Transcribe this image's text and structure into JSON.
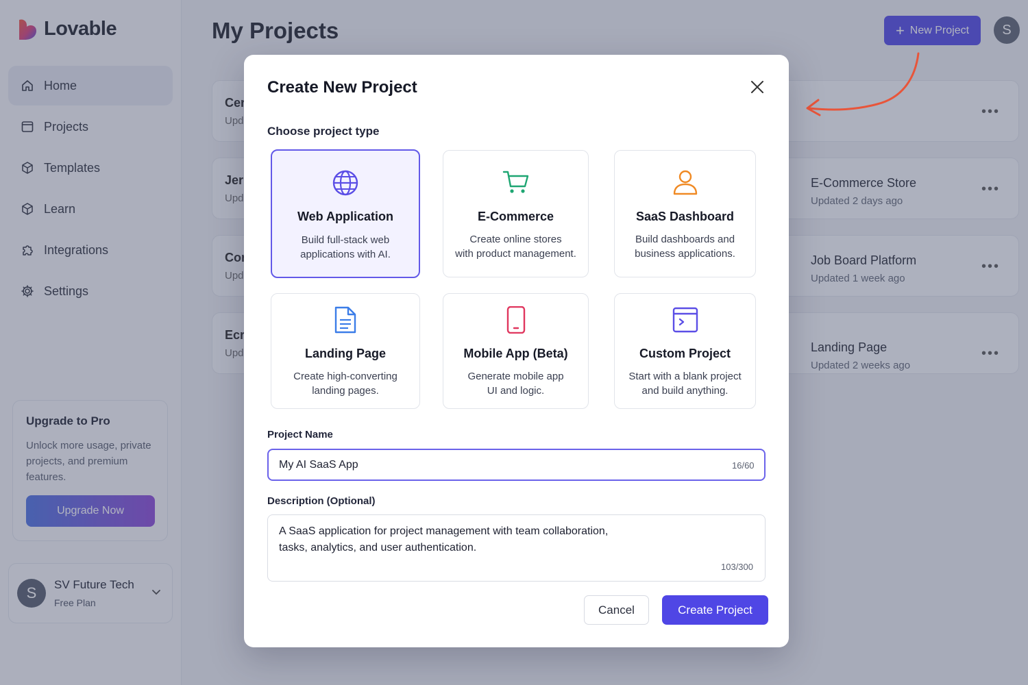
{
  "app": {
    "name": "Lovable"
  },
  "sidebar": {
    "items": [
      {
        "label": "Home",
        "icon": "home-icon"
      },
      {
        "label": "Projects",
        "icon": "folder-icon"
      },
      {
        "label": "Templates",
        "icon": "box-icon"
      },
      {
        "label": "Learn",
        "icon": "box-icon"
      },
      {
        "label": "Integrations",
        "icon": "puzzle-icon"
      },
      {
        "label": "Settings",
        "icon": "gear-icon"
      }
    ],
    "active": "Home",
    "upgrade": {
      "title": "Upgrade to Pro",
      "text": "Unlock more usage, private projects, and premium features.",
      "button": "Upgrade Now"
    },
    "account": {
      "initial": "S",
      "name": "SV Future Tech",
      "plan": "Free Plan"
    }
  },
  "header": {
    "title": "My Projects",
    "new_project": "New Project",
    "avatar_initial": "S"
  },
  "projects": {
    "left": [
      {
        "title": "Cer",
        "sub": "Upd"
      },
      {
        "title": "Jer",
        "sub": "Upd"
      },
      {
        "title": "Cor",
        "sub": "Upd"
      },
      {
        "title": "Ecr",
        "sub": "Upd"
      }
    ],
    "right": [
      {
        "title": "",
        "sub": ""
      },
      {
        "title": "E-Commerce Store",
        "sub": "Updated 2 days ago"
      },
      {
        "title": "Job Board Platform",
        "sub": "Updated 1 week ago"
      },
      {
        "title": "Landing Page",
        "sub": "Updated 2 weeks ago"
      }
    ]
  },
  "modal": {
    "title": "Create New Project",
    "choose_label": "Choose project type",
    "types": [
      {
        "title": "Web Application",
        "desc": "Build full-stack web\napplications with AI.",
        "icon": "globe-icon",
        "color": "#5b4ee6",
        "selected": true
      },
      {
        "title": "E-Commerce",
        "desc": "Create online stores\nwith product management.",
        "icon": "cart-icon",
        "color": "#1ea672",
        "selected": false
      },
      {
        "title": "SaaS Dashboard",
        "desc": "Build dashboards and\nbusiness applications.",
        "icon": "user-icon",
        "color": "#f08a24",
        "selected": false
      },
      {
        "title": "Landing Page",
        "desc": "Create high-converting\nlanding pages.",
        "icon": "document-icon",
        "color": "#3b7de8",
        "selected": false
      },
      {
        "title": "Mobile App (Beta)",
        "desc": "Generate mobile app\nUI and logic.",
        "icon": "mobile-icon",
        "color": "#e0365e",
        "selected": false
      },
      {
        "title": "Custom Project",
        "desc": "Start with a blank project\nand build anything.",
        "icon": "code-window-icon",
        "color": "#5b4ee6",
        "selected": false
      }
    ],
    "name_label": "Project Name",
    "name_value": "My AI SaaS App",
    "name_counter": "16/60",
    "desc_label": "Description (Optional)",
    "desc_value": "A SaaS application for project management with team collaboration,\ntasks, analytics, and user authentication.",
    "desc_counter": "103/300",
    "cancel": "Cancel",
    "create": "Create Project"
  },
  "colors": {
    "accent": "#4f46e5",
    "annotation_arrow": "#e8553a"
  }
}
